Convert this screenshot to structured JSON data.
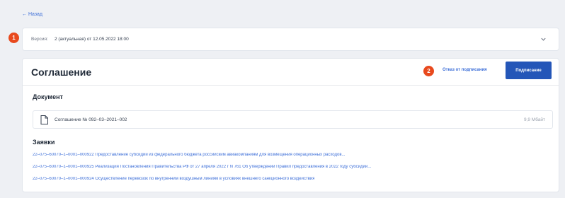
{
  "back": {
    "label": "← Назад"
  },
  "version": {
    "badge": "1",
    "label": "Версия:",
    "value": "2 (актуальная) от 12.05.2022 18:00"
  },
  "agreement": {
    "title": "Соглашение",
    "badge": "2",
    "refuse_label": "Отказ от подписания",
    "sign_label": "Подписание"
  },
  "document": {
    "section_title": "Документ",
    "file_name": "Соглашение № 092–03–2021–002",
    "file_size": "9,9 Мбайт"
  },
  "requests": {
    "section_title": "Заявки",
    "items": [
      "22–075–60070–1–0001–000922 Предоставление субсидий из федерального бюджета российским авиакомпаниям для возмещения операционных расходов...",
      "22–075–60070–1–0001–000925 Реализация Постановления Правительства РФ от 27 апреля 2022 г N 761 Об утверждении Правил предоставления в 2022 году субсидий...",
      "22–075–60070–1–0001–000924 Осуществление перевозок по внутренним воздушным линиям в условиях внешнего санкционного воздействия"
    ]
  }
}
